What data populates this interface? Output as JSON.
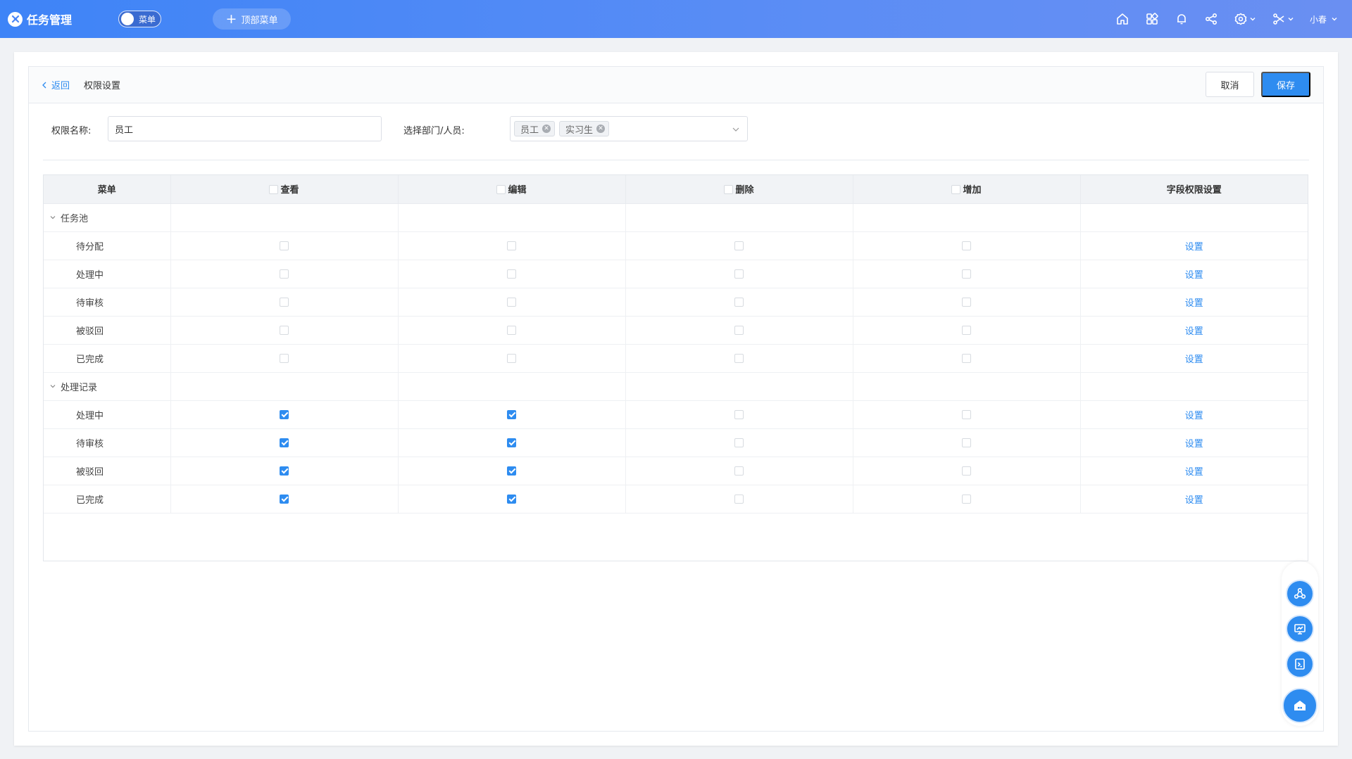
{
  "app": {
    "title": "任务管理"
  },
  "topbar": {
    "menu_toggle_label": "菜单",
    "top_menu_label": "顶部菜单",
    "user_name": "小春"
  },
  "header": {
    "back_label": "返回",
    "title": "权限设置",
    "cancel_label": "取消",
    "save_label": "保存"
  },
  "form": {
    "name_label": "权限名称:",
    "name_value": "员工",
    "dept_label": "选择部门/人员:",
    "dept_tags": [
      "员工",
      "实习生"
    ]
  },
  "table": {
    "headers": {
      "menu": "菜单",
      "view": "查看",
      "edit": "编辑",
      "delete": "删除",
      "add": "增加",
      "field": "字段权限设置"
    },
    "action_label": "设置",
    "groups": [
      {
        "name": "任务池",
        "rows": [
          {
            "name": "待分配",
            "view": false,
            "edit": false,
            "delete": false,
            "add": false
          },
          {
            "name": "处理中",
            "view": false,
            "edit": false,
            "delete": false,
            "add": false
          },
          {
            "name": "待审核",
            "view": false,
            "edit": false,
            "delete": false,
            "add": false
          },
          {
            "name": "被驳回",
            "view": false,
            "edit": false,
            "delete": false,
            "add": false
          },
          {
            "name": "已完成",
            "view": false,
            "edit": false,
            "delete": false,
            "add": false
          }
        ]
      },
      {
        "name": "处理记录",
        "rows": [
          {
            "name": "处理中",
            "view": true,
            "edit": true,
            "delete": false,
            "add": false
          },
          {
            "name": "待审核",
            "view": true,
            "edit": true,
            "delete": false,
            "add": false
          },
          {
            "name": "被驳回",
            "view": true,
            "edit": true,
            "delete": false,
            "add": false
          },
          {
            "name": "已完成",
            "view": true,
            "edit": true,
            "delete": false,
            "add": false
          }
        ]
      }
    ]
  },
  "colors": {
    "accent": "#2e8cf0",
    "topbar": "#3e84f7"
  },
  "icons": [
    "home-icon",
    "apps-icon",
    "bell-icon",
    "share-icon",
    "settings-icon",
    "tools-icon",
    "workflow-icon",
    "monitor-icon",
    "terminal-icon",
    "house-icon"
  ]
}
